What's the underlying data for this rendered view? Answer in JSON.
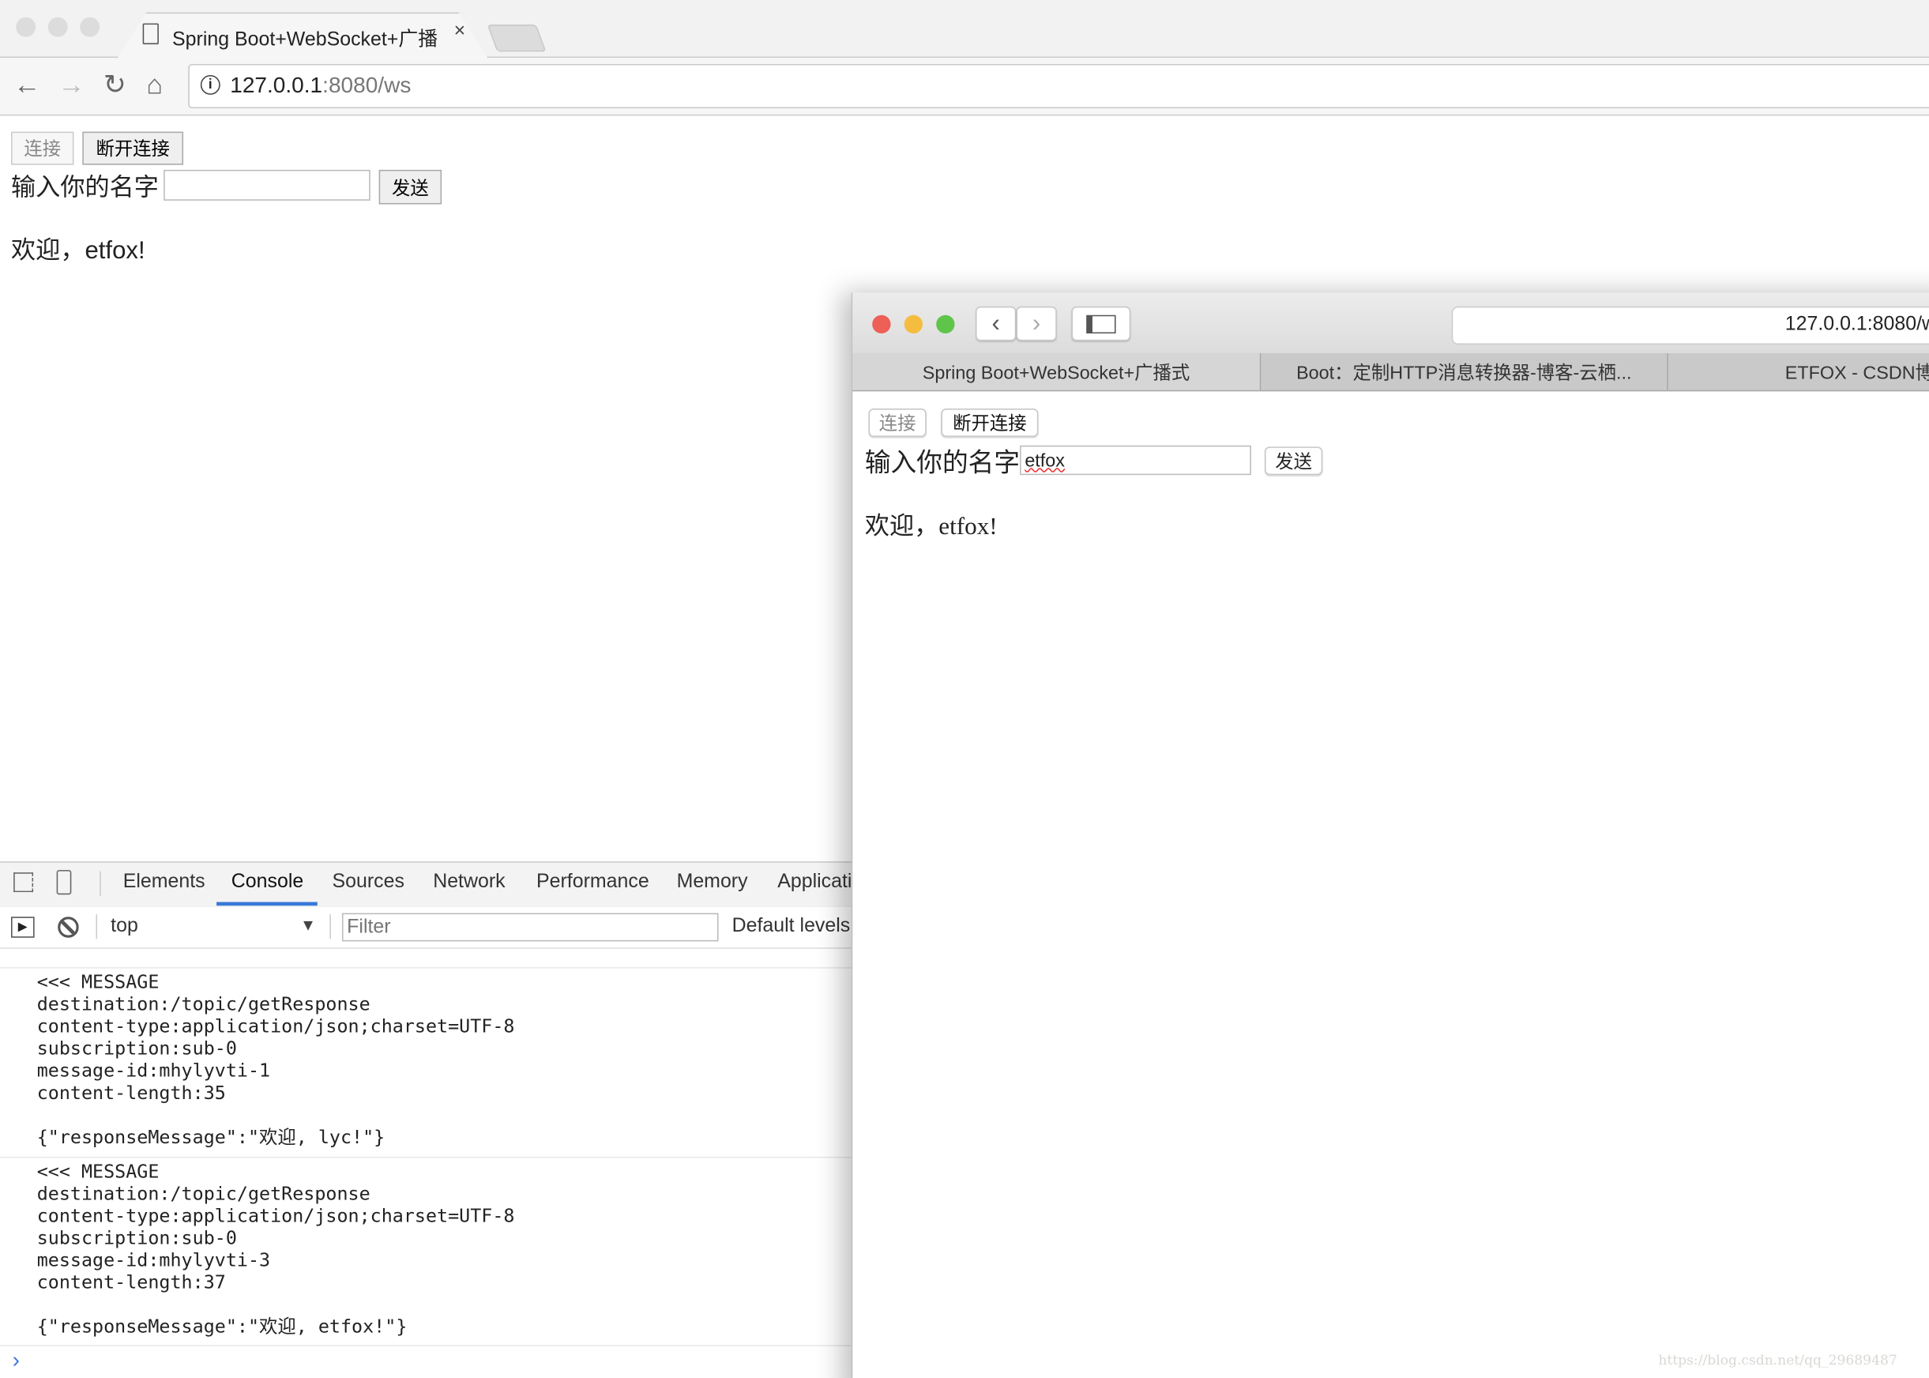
{
  "chrome": {
    "tab_title": "Spring Boot+WebSocket+广播式",
    "url_host": "127.0.0.1",
    "url_rest": ":8080/ws"
  },
  "page": {
    "connect_label": "连接",
    "disconnect_label": "断开连接",
    "name_label": "输入你的名字",
    "name_value": "",
    "send_label": "发送",
    "welcome": "欢迎，etfox!"
  },
  "devtools": {
    "tabs": [
      "Elements",
      "Console",
      "Sources",
      "Network",
      "Performance",
      "Memory",
      "Applicati"
    ],
    "active_tab": "Console",
    "context": "top",
    "filter_placeholder": "Filter",
    "levels": "Default levels",
    "messages": [
      {
        "lines": "<<< MESSAGE\ndestination:/topic/getResponse\ncontent-type:application/json;charset=UTF-8\nsubscription:sub-0\nmessage-id:mhylyvti-1\ncontent-length:35\n\n{\"responseMessage\":\"欢迎, lyc!\"}"
      },
      {
        "lines": "<<< MESSAGE\ndestination:/topic/getResponse\ncontent-type:application/json;charset=UTF-8\nsubscription:sub-0\nmessage-id:mhylyvti-3\ncontent-length:37\n\n{\"responseMessage\":\"欢迎, etfox!\"}"
      }
    ],
    "prompt": "›"
  },
  "safari": {
    "url": "127.0.0.1:8080/w",
    "tabs": [
      "Spring Boot+WebSocket+广播式",
      "Boot：定制HTTP消息转换器-博客-云栖...",
      "ETFOX - CSDN博客"
    ],
    "connect_label": "连接",
    "disconnect_label": "断开连接",
    "name_label": "输入你的名字",
    "name_value": "etfox",
    "send_label": "发送",
    "welcome": "欢迎，etfox!"
  },
  "watermark": "https://blog.csdn.net/qq_29689487"
}
